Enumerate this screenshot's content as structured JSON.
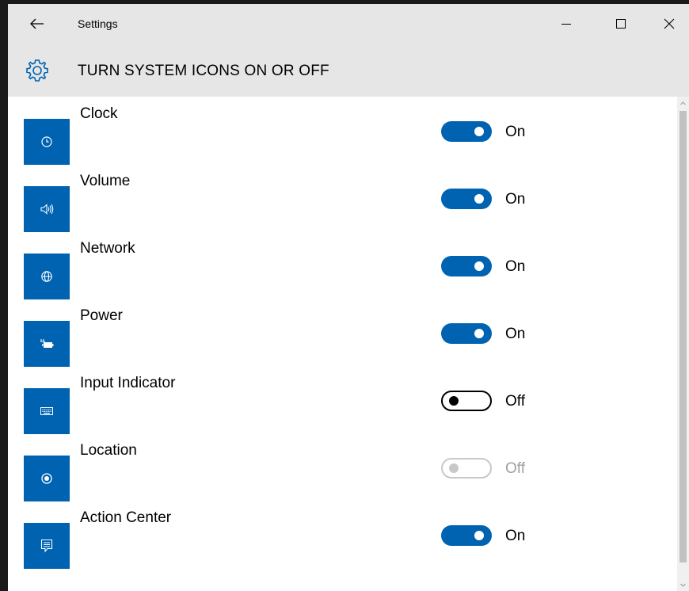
{
  "window": {
    "title": "Settings",
    "back_icon": "back-arrow-icon",
    "minimize_icon": "minimize-icon",
    "maximize_icon": "maximize-icon",
    "close_icon": "close-icon"
  },
  "header": {
    "icon": "gear-icon",
    "title": "TURN SYSTEM ICONS ON OR OFF"
  },
  "colors": {
    "accent": "#0063b1",
    "header_bg": "#e6e6e6",
    "disabled": "#c8c8c8"
  },
  "items": [
    {
      "label": "Clock",
      "icon": "clock-icon",
      "state": "On",
      "enabled": true,
      "on": true
    },
    {
      "label": "Volume",
      "icon": "volume-icon",
      "state": "On",
      "enabled": true,
      "on": true
    },
    {
      "label": "Network",
      "icon": "network-globe-icon",
      "state": "On",
      "enabled": true,
      "on": true
    },
    {
      "label": "Power",
      "icon": "power-battery-icon",
      "state": "On",
      "enabled": true,
      "on": true
    },
    {
      "label": "Input Indicator",
      "icon": "keyboard-icon",
      "state": "Off",
      "enabled": true,
      "on": false
    },
    {
      "label": "Location",
      "icon": "location-icon",
      "state": "Off",
      "enabled": false,
      "on": false
    },
    {
      "label": "Action Center",
      "icon": "action-center-icon",
      "state": "On",
      "enabled": true,
      "on": true
    }
  ]
}
